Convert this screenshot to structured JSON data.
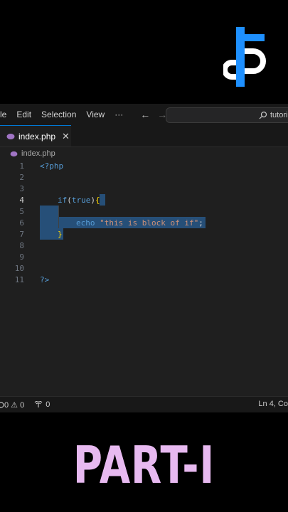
{
  "menu": {
    "items": [
      "le",
      "Edit",
      "Selection",
      "View",
      "···"
    ],
    "back": "←",
    "forward": "→",
    "search_text": "tutori"
  },
  "tab": {
    "label": "index.php",
    "close": "✕"
  },
  "breadcrumb": {
    "label": "index.php"
  },
  "code": {
    "line_numbers": [
      "1",
      "2",
      "3",
      "4",
      "5",
      "6",
      "7",
      "8",
      "9",
      "10",
      "11"
    ],
    "open_tag": "<?php",
    "if_kw": "if",
    "paren_open": "(",
    "true_kw": "true",
    "paren_close": ")",
    "brace_open": "{",
    "echo_kw": "echo",
    "string": "\"this is block of if\"",
    "semicolon": ";",
    "brace_close": "}",
    "close_tag": "?>"
  },
  "status": {
    "left": "0 ⚠ 0",
    "ports": "0",
    "right": "Ln 4, Co"
  },
  "overlay_title": "PART-I",
  "colors": {
    "title": "#e7b9f0",
    "selection": "#264f78",
    "logo_blue": "#1e90ff"
  }
}
